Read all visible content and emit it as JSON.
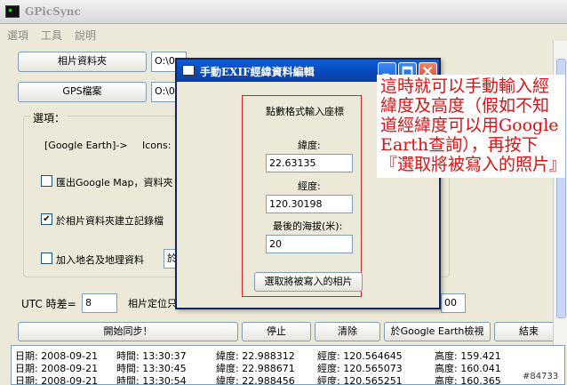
{
  "app": {
    "title": "GPicSync"
  },
  "menu": [
    "選項",
    "工具",
    "說明"
  ],
  "photo_folder": {
    "button": "相片資料夾",
    "value": "O:\\0"
  },
  "gps_file": {
    "button": "GPS檔案",
    "value": "O:\\0"
  },
  "options": {
    "title": "選項：",
    "google_earth_label": "[Google Earth]->",
    "icons_label": "Icons:",
    "export_google_map": {
      "label": "匯出Google Map，資料夾",
      "checked": false
    },
    "create_log": {
      "label": "於相片資料夾建立記錄檔",
      "checked": true
    },
    "add_geonames": {
      "label": "加入地名及地理資料",
      "checked": false,
      "field_value": "於"
    }
  },
  "utc": {
    "label": "UTC 時差=",
    "value": "8",
    "photo_position_label": "相片定位只",
    "tolerance_value": "00"
  },
  "actions": {
    "start_sync": "開始同步！",
    "stop": "停止",
    "clear": "清除",
    "google_earth_view": "於Google Earth檢視",
    "end": "結束"
  },
  "log": [
    {
      "date": "日期: 2008-09-21",
      "time": "時間: 13:30:37",
      "lat": "緯度: 22.988312",
      "lon": "經度: 120.564645",
      "alt": "高度: 159.421"
    },
    {
      "date": "日期: 2008-09-21",
      "time": "時間: 13:30:45",
      "lat": "緯度: 22.988671",
      "lon": "經度: 120.565073",
      "alt": "高度: 160.041"
    },
    {
      "date": "日期: 2008-09-21",
      "time": "時間: 13:30:54",
      "lat": "緯度: 22.988456",
      "lon": "經度: 120.565251",
      "alt": "高度: 160.365"
    }
  ],
  "dialog": {
    "title": "手動EXIF經緯資料編輯",
    "decimal_input_label": "點數格式輸入座標",
    "latitude_label": "緯度:",
    "latitude_value": "22.63135",
    "longitude_label": "經度:",
    "longitude_value": "120.30198",
    "altitude_label": "最後的海拔(米):",
    "altitude_value": "20",
    "select_photo_button": "選取將被寫入的相片"
  },
  "annotation": "這時就可以手動輸入經緯度及高度（假如不知道經緯度可以用Google Earth查詢），再按下『選取將被寫入的照片』",
  "watermark": "#84733"
}
